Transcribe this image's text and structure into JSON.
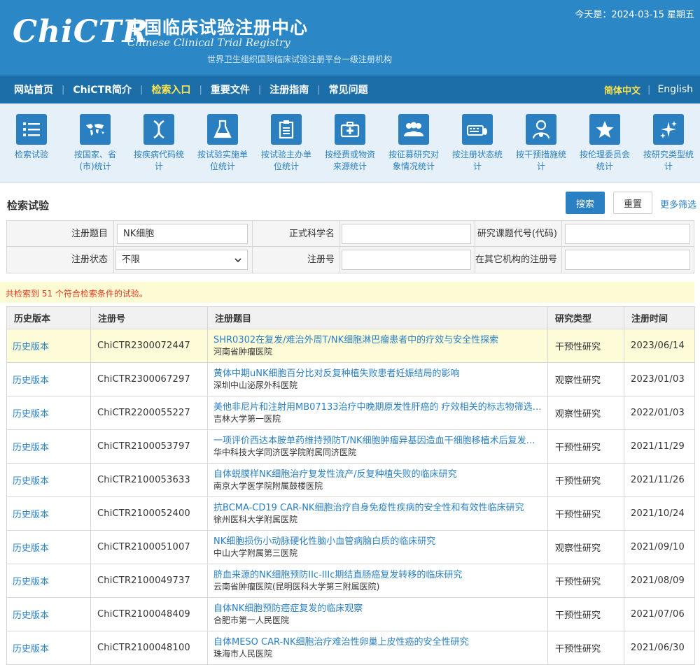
{
  "header": {
    "logo": "ChiCTR",
    "title_cn": "中国临床试验注册中心",
    "title_en": "Chinese Clinical Trial Registry",
    "subtitle": "世界卫生组织国际临床试验注册平台一级注册机构",
    "today": "今天是：2024-03-15 星期五"
  },
  "nav": {
    "items": [
      {
        "label": "网站首页"
      },
      {
        "label": "ChiCTR简介"
      },
      {
        "label": "检索入口"
      },
      {
        "label": "重要文件"
      },
      {
        "label": "注册指南"
      },
      {
        "label": "常见问题"
      }
    ],
    "lang_cn": "简体中文",
    "lang_en": "English"
  },
  "categories": [
    {
      "label": "检索试验",
      "icon": "list-icon"
    },
    {
      "label": "按国家、省(市)统计",
      "icon": "world-map-icon"
    },
    {
      "label": "按疾病代码统计",
      "icon": "dna-icon"
    },
    {
      "label": "按试验实施单位统计",
      "icon": "flask-icon"
    },
    {
      "label": "按试验主办单位统计",
      "icon": "clipboard-icon"
    },
    {
      "label": "按经费或物资来源统计",
      "icon": "medkit-icon"
    },
    {
      "label": "按征募研究对象情况统计",
      "icon": "group-icon"
    },
    {
      "label": "按注册状态统计",
      "icon": "keyboard-icon"
    },
    {
      "label": "按干预措施统计",
      "icon": "doctor-icon"
    },
    {
      "label": "按伦理委员会统计",
      "icon": "star-icon"
    },
    {
      "label": "按研究类型统计",
      "icon": "sparkle-icon"
    }
  ],
  "search": {
    "title": "检索试验",
    "search_btn": "搜索",
    "reset_btn": "重置",
    "more": "更多筛选",
    "fields": {
      "reg_title_label": "注册题目",
      "reg_title_value": "NK细胞",
      "sci_name_label": "正式科学名",
      "sci_name_value": "",
      "code_label": "研究课题代号(代码)",
      "code_value": "",
      "status_label": "注册状态",
      "status_value": "不限",
      "reg_no_label": "注册号",
      "reg_no_value": "",
      "other_reg_label": "在其它机构的注册号",
      "other_reg_value": ""
    },
    "result": "共检索到 51 个符合检索条件的试验。"
  },
  "table": {
    "headers": {
      "history": "历史版本",
      "reg_no": "注册号",
      "title": "注册题目",
      "type": "研究类型",
      "date": "注册时间"
    },
    "rows": [
      {
        "history": "历史版本",
        "reg_no": "ChiCTR2300072447",
        "title": "SHR0302在复发/难治外周T/NK细胞淋巴瘤患者中的疗效与安全性探索",
        "org": "河南省肿瘤医院",
        "type": "干预性研究",
        "date": "2023/06/14"
      },
      {
        "history": "历史版本",
        "reg_no": "ChiCTR2300067297",
        "title": "黄体中期uNK细胞百分比对反复种植失败患者妊娠结局的影响",
        "org": "深圳中山泌尿外科医院",
        "type": "观察性研究",
        "date": "2023/01/03"
      },
      {
        "history": "历史版本",
        "reg_no": "ChiCTR2200055227",
        "title": "美他非尼片和注射用MB07133治疗中晚期原发性肝癌的 疗效相关的标志物筛选及...",
        "org": "吉林大学第一医院",
        "type": "观察性研究",
        "date": "2022/01/03"
      },
      {
        "history": "历史版本",
        "reg_no": "ChiCTR2100053797",
        "title": "一项评价西达本胺单药维持预防T/NK细胞肿瘤异基因造血干细胞移植术后复发的...",
        "org": "华中科技大学同济医学院附属同济医院",
        "type": "干预性研究",
        "date": "2021/11/29"
      },
      {
        "history": "历史版本",
        "reg_no": "ChiCTR2100053633",
        "title": "自体蜕膜样NK细胞治疗复发性流产/反复种植失败的临床研究",
        "org": "南京大学医学院附属鼓楼医院",
        "type": "干预性研究",
        "date": "2021/11/26"
      },
      {
        "history": "历史版本",
        "reg_no": "ChiCTR2100052400",
        "title": "抗BCMA-CD19 CAR-NK细胞治疗自身免疫性疾病的安全性和有效性临床研究",
        "org": "徐州医科大学附属医院",
        "type": "干预性研究",
        "date": "2021/10/24"
      },
      {
        "history": "历史版本",
        "reg_no": "ChiCTR2100051007",
        "title": "NK细胞损伤小动脉硬化性脑小血管病脑白质的临床研究",
        "org": "中山大学附属第三医院",
        "type": "观察性研究",
        "date": "2021/09/10"
      },
      {
        "history": "历史版本",
        "reg_no": "ChiCTR2100049737",
        "title": "脐血来源的NK细胞预防IIc-IIIc期结直肠癌复发转移的临床研究",
        "org": "云南省肿瘤医院(昆明医科大学第三附属医院)",
        "type": "干预性研究",
        "date": "2021/08/09"
      },
      {
        "history": "历史版本",
        "reg_no": "ChiCTR2100048409",
        "title": "自体NK细胞预防癌症复发的临床观察",
        "org": "合肥市第一人民医院",
        "type": "干预性研究",
        "date": "2021/07/06"
      },
      {
        "history": "历史版本",
        "reg_no": "ChiCTR2100048100",
        "title": "自体MESO CAR-NK细胞治疗难治性卵巢上皮性癌的安全性研究",
        "org": "珠海市人民医院",
        "type": "干预性研究",
        "date": "2021/06/30"
      }
    ]
  }
}
